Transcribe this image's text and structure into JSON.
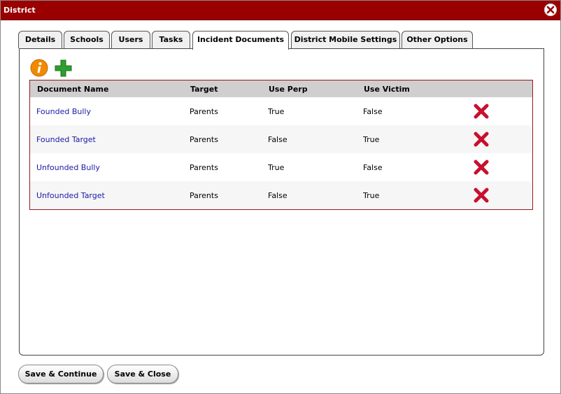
{
  "window": {
    "title": "District"
  },
  "tabs": [
    {
      "label": "Details"
    },
    {
      "label": "Schools"
    },
    {
      "label": "Users"
    },
    {
      "label": "Tasks"
    },
    {
      "label": "Incident Documents",
      "active": true
    },
    {
      "label": "District Mobile Settings"
    },
    {
      "label": "Other Options"
    }
  ],
  "toolbar": {
    "info_icon": "info-icon",
    "add_icon": "plus-icon"
  },
  "table": {
    "columns": [
      "Document Name",
      "Target",
      "Use Perp",
      "Use Victim"
    ],
    "rows": [
      {
        "name": "Founded Bully",
        "target": "Parents",
        "use_perp": "True",
        "use_victim": "False"
      },
      {
        "name": "Founded Target",
        "target": "Parents",
        "use_perp": "False",
        "use_victim": "True"
      },
      {
        "name": "Unfounded Bully",
        "target": "Parents",
        "use_perp": "True",
        "use_victim": "False"
      },
      {
        "name": "Unfounded Target",
        "target": "Parents",
        "use_perp": "False",
        "use_victim": "True"
      }
    ]
  },
  "buttons": {
    "save_continue": "Save & Continue",
    "save_close": "Save & Close"
  },
  "colors": {
    "titlebar": "#9a0000",
    "link": "#1a1aa6",
    "delete": "#c8102e",
    "add": "#2e9e2e",
    "info": "#f08a00"
  }
}
